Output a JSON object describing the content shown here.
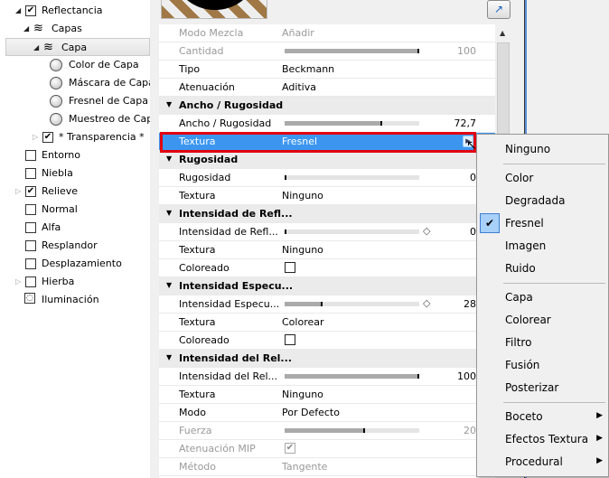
{
  "tree": [
    {
      "label": "Reflectancia",
      "type": "checkbox",
      "checked": true,
      "arrow": "open",
      "level": 0
    },
    {
      "label": "Capas",
      "type": "layers",
      "arrow": "open",
      "level": 1
    },
    {
      "label": "Capa",
      "type": "layers",
      "arrow": "open",
      "level": 2,
      "selected": true
    },
    {
      "label": "Color de Capa",
      "type": "radio",
      "level": 3
    },
    {
      "label": "Máscara de Capa",
      "type": "radio",
      "level": 3
    },
    {
      "label": "Fresnel de Capa",
      "type": "radio",
      "level": 3
    },
    {
      "label": "Muestreo de Capa",
      "type": "radio",
      "level": 3
    },
    {
      "label": "* Transparencia *",
      "type": "checkbox",
      "checked": true,
      "arrow": "closed",
      "level": 2
    },
    {
      "label": "Entorno",
      "type": "checkbox",
      "checked": false,
      "level": 0
    },
    {
      "label": "Niebla",
      "type": "checkbox",
      "checked": false,
      "level": 0
    },
    {
      "label": "Relieve",
      "type": "checkbox",
      "checked": true,
      "arrow": "closed",
      "level": 0
    },
    {
      "label": "Normal",
      "type": "checkbox",
      "checked": false,
      "level": 0
    },
    {
      "label": "Alfa",
      "type": "checkbox",
      "checked": false,
      "level": 0
    },
    {
      "label": "Resplandor",
      "type": "checkbox",
      "checked": false,
      "level": 0
    },
    {
      "label": "Desplazamiento",
      "type": "checkbox",
      "checked": false,
      "level": 0
    },
    {
      "label": "Hierba",
      "type": "checkbox",
      "checked": false,
      "arrow": "closed",
      "level": 0
    },
    {
      "label": "Iluminación",
      "type": "bulb",
      "level": 0
    }
  ],
  "properties": [
    {
      "kind": "text",
      "label": "Modo Mezcla",
      "value": "Añadir",
      "disabled": true
    },
    {
      "kind": "slider",
      "label": "Cantidad",
      "value": "100",
      "fill": 1.0,
      "disabled": true
    },
    {
      "kind": "text",
      "label": "Tipo",
      "value": "Beckmann"
    },
    {
      "kind": "text",
      "label": "Atenuación",
      "value": "Aditiva"
    },
    {
      "kind": "header",
      "label": "Ancho / Rugosidad"
    },
    {
      "kind": "slider",
      "label": "Ancho / Rugosidad",
      "value": "72,7",
      "fill": 0.727
    },
    {
      "kind": "text",
      "label": "Textura",
      "value": "Fresnel",
      "selected": true
    },
    {
      "kind": "header",
      "label": "Rugosidad"
    },
    {
      "kind": "slider",
      "label": "Rugosidad",
      "value": "0",
      "fill": 0
    },
    {
      "kind": "text",
      "label": "Textura",
      "value": "Ninguno"
    },
    {
      "kind": "header",
      "label": "Intensidad de Refl..."
    },
    {
      "kind": "slider",
      "label": "Intensidad de Refl...",
      "value": "0",
      "fill": 0,
      "keyframe": true
    },
    {
      "kind": "text",
      "label": "Textura",
      "value": "Ninguno"
    },
    {
      "kind": "checkbox",
      "label": "Coloreado",
      "checked": false
    },
    {
      "kind": "header",
      "label": "Intensidad Especu..."
    },
    {
      "kind": "slider",
      "label": "Intensidad Especu...",
      "value": "28",
      "fill": 0.28,
      "keyframe": true
    },
    {
      "kind": "text",
      "label": "Textura",
      "value": "Colorear"
    },
    {
      "kind": "checkbox",
      "label": "Coloreado",
      "checked": false
    },
    {
      "kind": "header",
      "label": "Intensidad del Rel..."
    },
    {
      "kind": "slider",
      "label": "Intensidad del Rel...",
      "value": "100",
      "fill": 1.0
    },
    {
      "kind": "text",
      "label": "Textura",
      "value": "Ninguno"
    },
    {
      "kind": "text",
      "label": "Modo",
      "value": "Por Defecto"
    },
    {
      "kind": "slider",
      "label": "Fuerza",
      "value": "20",
      "fill": 0.6,
      "disabled": true
    },
    {
      "kind": "checkbox",
      "label": "Atenuación MIP",
      "checked": true,
      "disabled": true
    },
    {
      "kind": "text",
      "label": "Método",
      "value": "Tangente",
      "disabled": true
    }
  ],
  "menu": [
    {
      "label": "Ninguno"
    },
    {
      "sep": true
    },
    {
      "label": "Color"
    },
    {
      "label": "Degradada"
    },
    {
      "label": "Fresnel",
      "checked": true
    },
    {
      "label": "Imagen"
    },
    {
      "label": "Ruido"
    },
    {
      "sep": true
    },
    {
      "label": "Capa"
    },
    {
      "label": "Colorear"
    },
    {
      "label": "Filtro"
    },
    {
      "label": "Fusión"
    },
    {
      "label": "Posterizar"
    },
    {
      "sep": true
    },
    {
      "label": "Boceto",
      "submenu": true
    },
    {
      "label": "Efectos Textura",
      "submenu": true
    },
    {
      "label": "Procedural",
      "submenu": true
    }
  ],
  "colors": {
    "selection": "#3c96f0",
    "highlight_box": "#e00010"
  }
}
